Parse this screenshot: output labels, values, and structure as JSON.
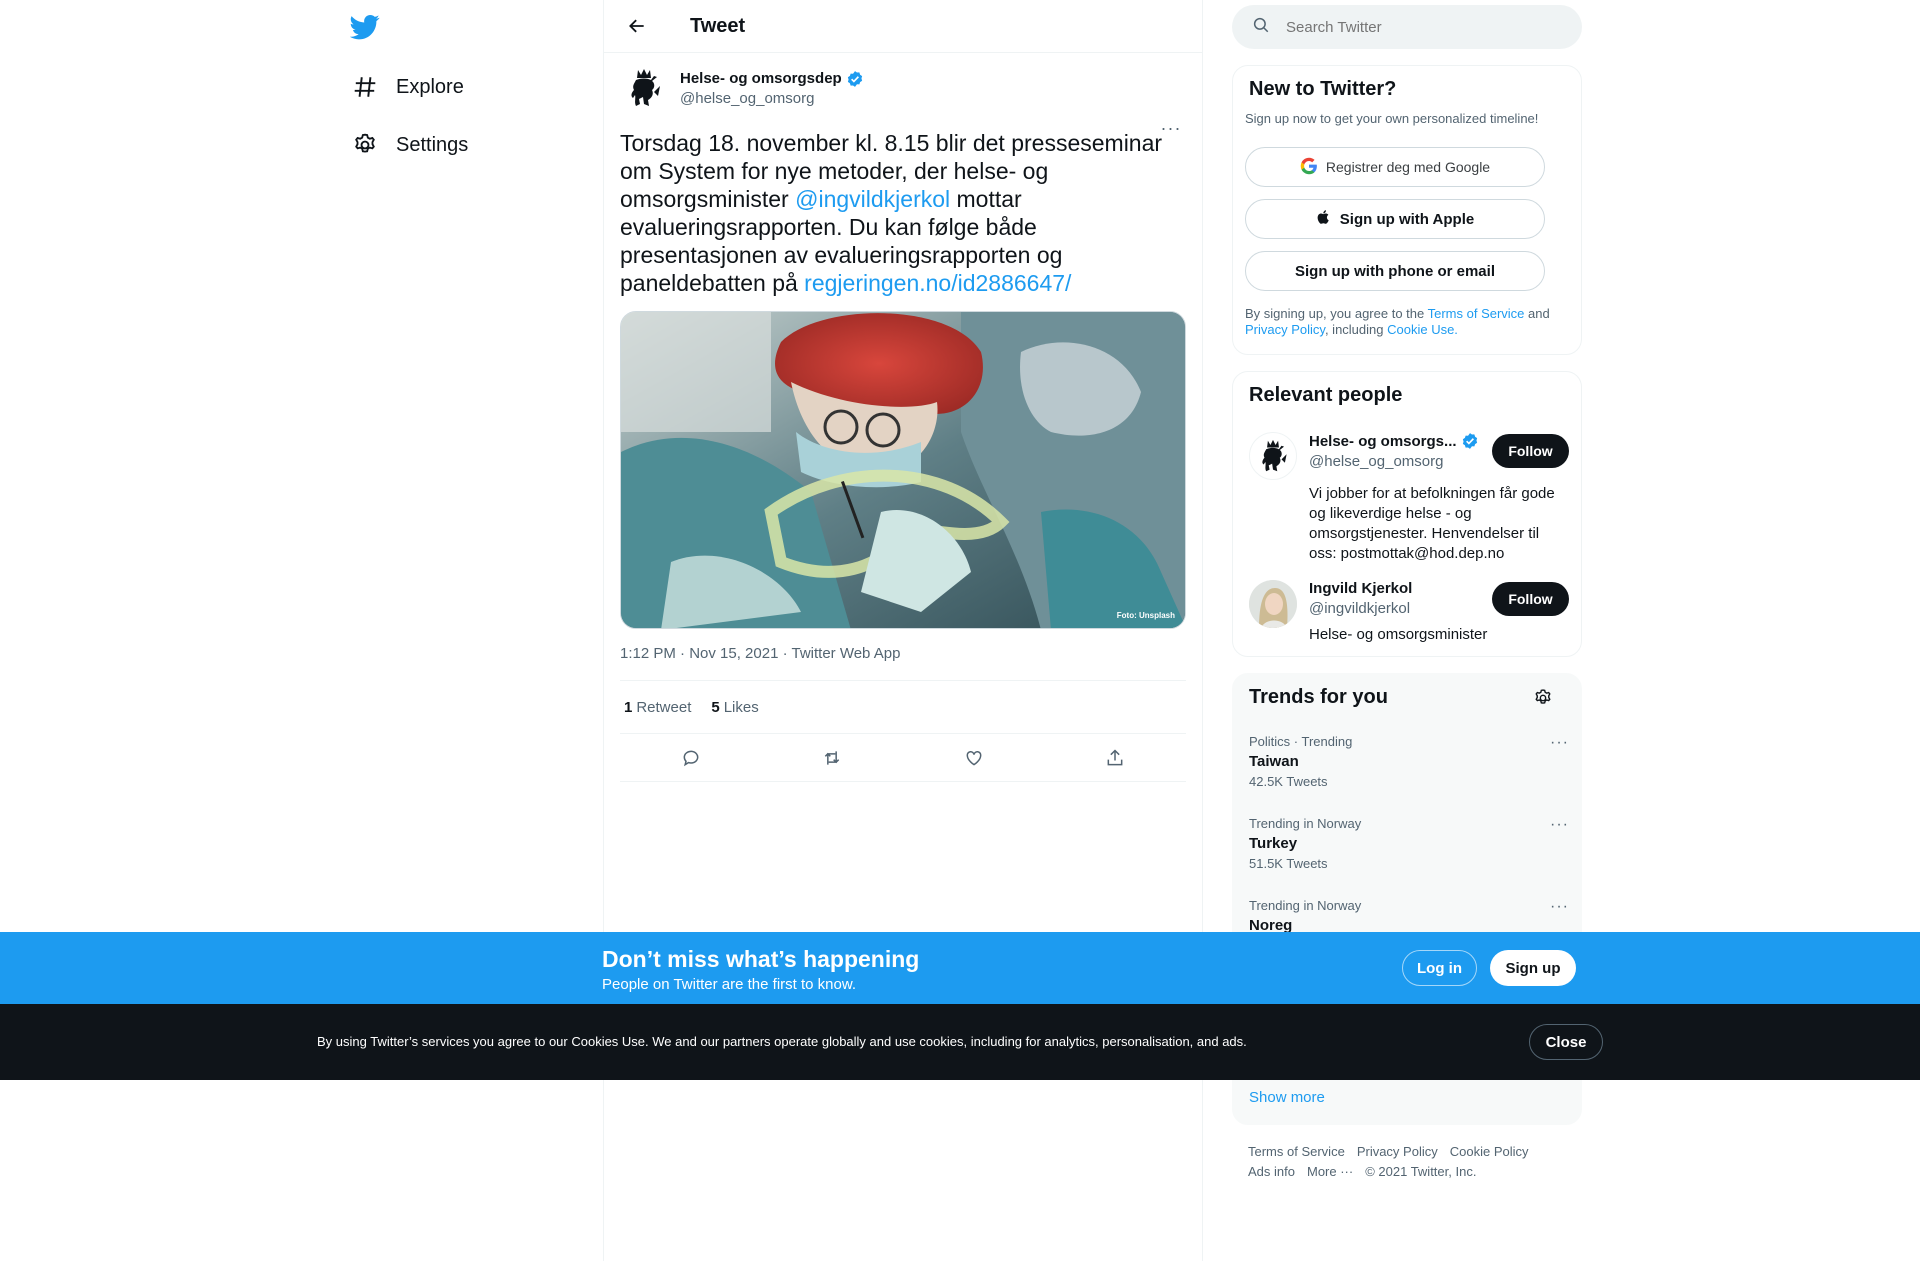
{
  "nav": {
    "logo": "twitter-bird-icon",
    "items": [
      {
        "label": "Explore",
        "icon": "hashtag-icon"
      },
      {
        "label": "Settings",
        "icon": "gear-icon"
      }
    ]
  },
  "header": {
    "title": "Tweet"
  },
  "tweet": {
    "author_name": "Helse- og omsorgsdep",
    "author_handle": "@helse_og_omsorg",
    "text_part1": "Torsdag 18. november kl. 8.15 blir det presseseminar om System for nye metoder, der helse- og omsorgsminister ",
    "mention": "@ingvildkjerkol",
    "text_part2": " mottar evalueringsrapporten. Du kan følge både presentasjonen av evalueringsrapporten og paneldebatten på ",
    "link": "regjeringen.no/id2886647/",
    "image_credit": "Foto: Unsplash",
    "timestamp": "1:12 PM · Nov 15, 2021 · Twitter Web App",
    "retweets_count": "1",
    "retweets_label": "Retweet",
    "likes_count": "5",
    "likes_label": "Likes"
  },
  "search": {
    "placeholder": "Search Twitter"
  },
  "new_to_twitter": {
    "title": "New to Twitter?",
    "subtitle": "Sign up now to get your own personalized timeline!",
    "google_label": "Registrer deg med Google",
    "apple_label": "Sign up with Apple",
    "phone_label": "Sign up with phone or email",
    "terms_prefix": "By signing up, you agree to the ",
    "terms_link": "Terms of Service",
    "terms_and": " and ",
    "privacy_link": "Privacy Policy",
    "terms_including": ", including ",
    "cookie_link": "Cookie Use."
  },
  "relevant": {
    "title": "Relevant people",
    "people": [
      {
        "name": "Helse- og omsorgs...",
        "handle": "@helse_og_omsorg",
        "bio": "Vi jobber for at befolkningen får gode og likeverdige helse - og omsorgstjenester. Henvendelser til oss: postmottak@hod.dep.no",
        "follow": "Follow"
      },
      {
        "name": "Ingvild Kjerkol",
        "handle": "@ingvildkjerkol",
        "bio": "Helse- og omsorgsminister",
        "follow": "Follow"
      }
    ]
  },
  "trends": {
    "title": "Trends for you",
    "items": [
      {
        "context": "Politics · Trending",
        "name": "Taiwan",
        "count": "42.5K Tweets"
      },
      {
        "context": "Trending in Norway",
        "name": "Turkey",
        "count": "51.5K Tweets"
      },
      {
        "context": "Trending in Norway",
        "name": "Noreg",
        "count": ""
      }
    ],
    "show_more": "Show more"
  },
  "footer": {
    "links": [
      "Terms of Service",
      "Privacy Policy",
      "Cookie Policy",
      "Ads info",
      "More ···",
      "© 2021 Twitter, Inc."
    ]
  },
  "banner": {
    "title": "Don’t miss what’s happening",
    "subtitle": "People on Twitter are the first to know.",
    "login": "Log in",
    "signup": "Sign up"
  },
  "cookie": {
    "text": "By using Twitter’s services you agree to our Cookies Use. We and our partners operate globally and use cookies, including for analytics, personalisation, and ads.",
    "close": "Close"
  },
  "colors": {
    "accent": "#1d9bf0",
    "text": "#0f1419",
    "muted": "#536471",
    "cookie_bg": "#0f1419"
  }
}
